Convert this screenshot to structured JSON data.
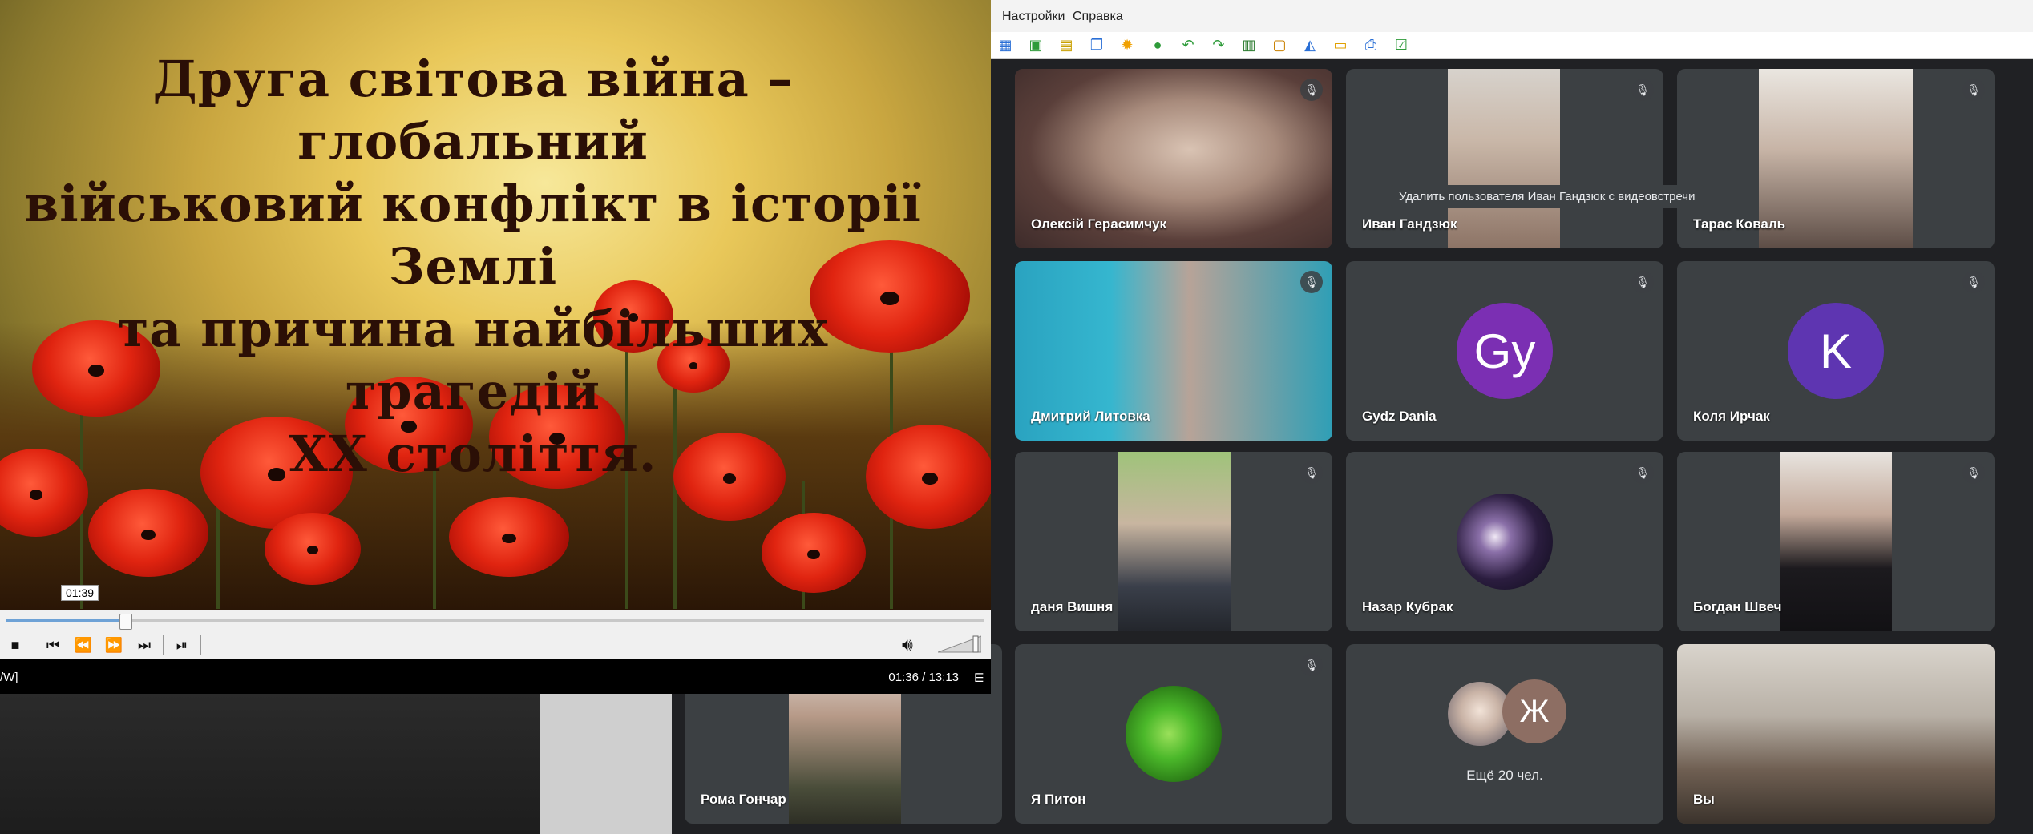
{
  "menubar": {
    "items": [
      "Настройки",
      "Справка"
    ]
  },
  "toolbar": {
    "buttons": [
      "grid-icon",
      "green-export-icon",
      "image-icon",
      "copy-icon",
      "sun-icon",
      "user-icon",
      "undo-icon",
      "redo-icon",
      "columns-icon",
      "screen-icon",
      "erase-icon",
      "folder-icon",
      "print-icon",
      "check-icon"
    ]
  },
  "slide": {
    "title_lines": [
      "Друга світова війна – глобальний",
      "військовий конфлікт в історії Землі",
      "та причина найбільших трагедій",
      "XX століття."
    ]
  },
  "player": {
    "time_tooltip": "01:39",
    "progress_fraction": 0.121,
    "status_left": "/W]",
    "time": "01:36 / 13:13",
    "status_icon": "⋿"
  },
  "tooltip": "Удалить пользователя Иван Гандзюк с видеовстречи",
  "participants": [
    {
      "name": "Олексій Герасимчук",
      "kind": "video",
      "muted": true
    },
    {
      "name": "Иван Гандзюк",
      "kind": "video",
      "muted": true
    },
    {
      "name": "Тарас Коваль",
      "kind": "video",
      "muted": true
    },
    {
      "name": "Дмитрий Литовка",
      "kind": "video",
      "muted": true
    },
    {
      "name": "Gydz Dania",
      "kind": "letter",
      "letter": "Gy",
      "color": "#7b2fb3",
      "muted": true
    },
    {
      "name": "Коля Ирчак",
      "kind": "letter",
      "letter": "K",
      "color": "#5e35b1",
      "muted": true
    },
    {
      "name": "даня Вишня",
      "kind": "video",
      "muted": true
    },
    {
      "name": "Назар Кубрак",
      "kind": "image",
      "muted": true
    },
    {
      "name": "Богдан Швеч",
      "kind": "video",
      "muted": true
    },
    {
      "name": "Рома Гончар",
      "kind": "video",
      "muted": false
    },
    {
      "name": "Я Питон",
      "kind": "image",
      "muted": true
    },
    {
      "name": "Ещё 20 чел.",
      "kind": "more",
      "letter": "Ж",
      "muted": false
    },
    {
      "name": "Вы",
      "kind": "video",
      "muted": false
    }
  ]
}
